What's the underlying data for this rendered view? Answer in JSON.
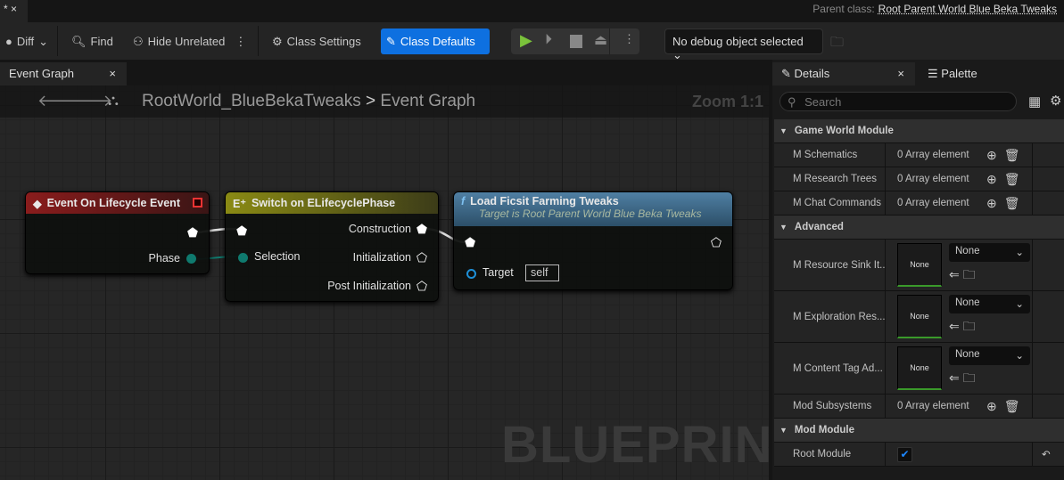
{
  "doc_tab": {
    "label": "* ×"
  },
  "parent_class": {
    "label": "Parent class:",
    "value": "Root Parent World Blue Beka Tweaks"
  },
  "toolbar": {
    "diff": "Diff",
    "find": "Find",
    "hide_unrelated": "Hide Unrelated",
    "class_settings": "Class Settings",
    "class_defaults": "Class Defaults",
    "debug_object": "No debug object selected"
  },
  "graph_tab": {
    "label": "Event Graph",
    "close": "×"
  },
  "breadcrumb": {
    "root": "RootWorld_BlueBekaTweaks",
    "sep": ">",
    "current": "Event Graph"
  },
  "zoom": "Zoom 1:1",
  "watermark": "BLUEPRINT",
  "nodes": {
    "event": {
      "title": "Event On Lifecycle Event",
      "pin_phase": "Phase"
    },
    "switch": {
      "title": "Switch on ELifecyclePhase",
      "pin_selection": "Selection",
      "out1": "Construction",
      "out2": "Initialization",
      "out3": "Post Initialization"
    },
    "load": {
      "title": "Load Ficsit Farming Tweaks",
      "subtitle": "Target is Root Parent World Blue Beka Tweaks",
      "pin_target": "Target",
      "target_value": "self"
    }
  },
  "panel": {
    "details_tab": "Details",
    "close": "×",
    "palette_tab": "Palette",
    "search_placeholder": "Search",
    "sections": [
      {
        "title": "Game World Module"
      },
      {
        "title": "Advanced"
      },
      {
        "title": "Mod Module"
      }
    ],
    "rows": {
      "schematics": {
        "label": "M Schematics",
        "value": "0 Array element"
      },
      "research": {
        "label": "M Research Trees",
        "value": "0 Array element"
      },
      "chat": {
        "label": "M Chat Commands",
        "value": "0 Array element"
      },
      "sink": {
        "label": "M Resource Sink It...",
        "thumb": "None",
        "select": "None"
      },
      "exploration": {
        "label": "M Exploration Res...",
        "thumb": "None",
        "select": "None"
      },
      "contenttag": {
        "label": "M Content Tag Ad...",
        "thumb": "None",
        "select": "None"
      },
      "subsystems": {
        "label": "Mod Subsystems",
        "value": "0 Array element"
      },
      "root": {
        "label": "Root Module",
        "checked": true
      }
    }
  },
  "colors": {
    "accent": "#0e70e0",
    "event_header": "#8a1c1c",
    "switch_header": "#8a8a14",
    "func_header": "#3f6f90",
    "exec_wire": "#e0e0e0",
    "enum_pin": "#0f7a6e"
  }
}
